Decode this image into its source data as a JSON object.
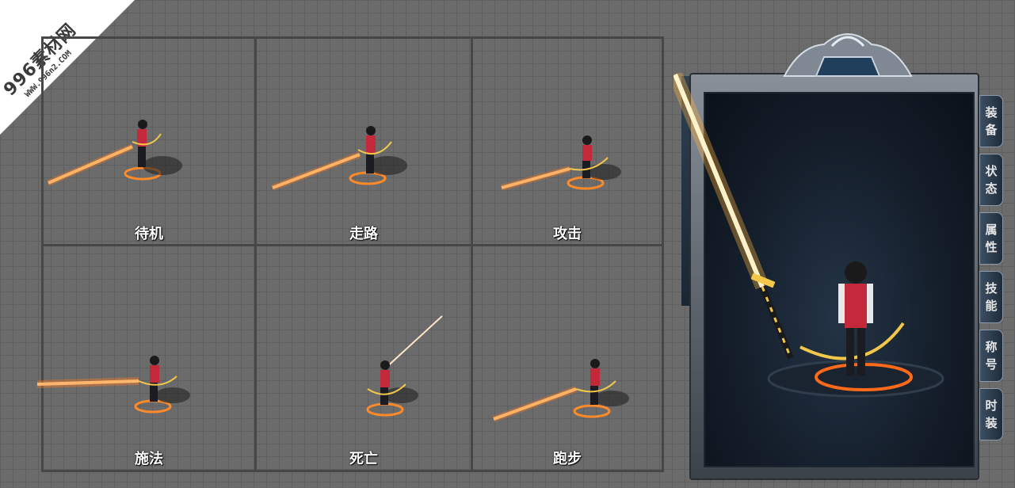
{
  "watermark": {
    "brand": "996素材网",
    "url": "WWW.996n2.COM"
  },
  "animations": [
    {
      "label": "待机"
    },
    {
      "label": "走路"
    },
    {
      "label": "攻击"
    },
    {
      "label": "施法"
    },
    {
      "label": "死亡"
    },
    {
      "label": "跑步"
    }
  ],
  "panel": {
    "tabs": [
      {
        "c1": "装",
        "c2": "备"
      },
      {
        "c1": "状",
        "c2": "态"
      },
      {
        "c1": "属",
        "c2": "性"
      },
      {
        "c1": "技",
        "c2": "能"
      },
      {
        "c1": "称",
        "c2": "号"
      },
      {
        "c1": "时",
        "c2": "装"
      }
    ]
  },
  "colors": {
    "grid_bg": "#6b6b6b",
    "grid_line": "#474747",
    "sword_glow": "#ff8a2a",
    "gold": "#f3c74a",
    "panel_dark": "#131c28"
  }
}
